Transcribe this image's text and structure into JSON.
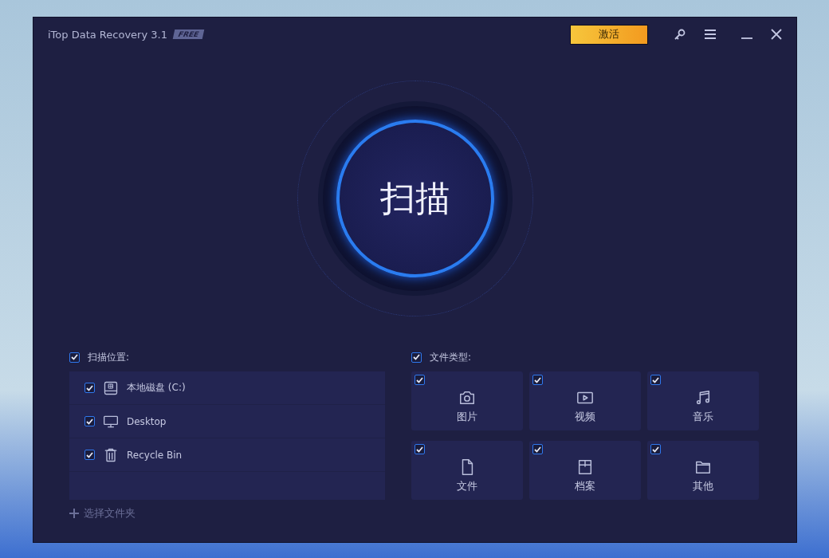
{
  "window": {
    "title": "iTop Data Recovery 3.1",
    "badge": "FREE",
    "activate_button": "激活"
  },
  "scan_button": {
    "label": "扫描"
  },
  "locations": {
    "label": "扫描位置:",
    "checked": true,
    "items": [
      {
        "kind": "drive",
        "label": "本地磁盘 (C:)",
        "checked": true
      },
      {
        "kind": "monitor",
        "label": "Desktop",
        "checked": true
      },
      {
        "kind": "trash",
        "label": "Recycle Bin",
        "checked": true
      }
    ],
    "add_folder": "选择文件夹"
  },
  "file_types": {
    "label": "文件类型:",
    "checked": true,
    "items": [
      {
        "kind": "image",
        "label": "图片",
        "checked": true
      },
      {
        "kind": "video",
        "label": "视频",
        "checked": true
      },
      {
        "kind": "music",
        "label": "音乐",
        "checked": true
      },
      {
        "kind": "document",
        "label": "文件",
        "checked": true
      },
      {
        "kind": "archive",
        "label": "档案",
        "checked": true
      },
      {
        "kind": "folder",
        "label": "其他",
        "checked": true
      }
    ]
  }
}
